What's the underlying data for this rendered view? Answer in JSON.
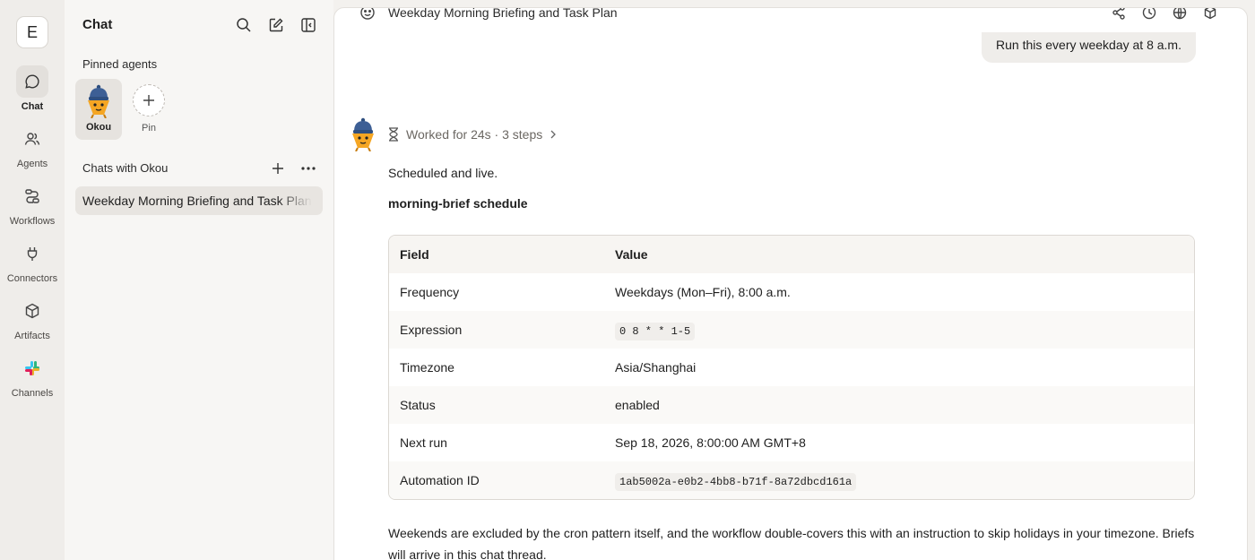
{
  "rail": {
    "workspace_initial": "E",
    "items": [
      {
        "label": "Chat",
        "icon": "chat-bubble-icon"
      },
      {
        "label": "Agents",
        "icon": "users-icon"
      },
      {
        "label": "Workflows",
        "icon": "workflow-icon"
      },
      {
        "label": "Connectors",
        "icon": "plug-icon"
      },
      {
        "label": "Artifacts",
        "icon": "cube-icon"
      },
      {
        "label": "Channels",
        "icon": "slack-icon"
      }
    ]
  },
  "sidebar": {
    "title": "Chat",
    "pinned_label": "Pinned agents",
    "agent_name": "Okou",
    "pin_label": "Pin",
    "chats_label": "Chats with Okou",
    "chat_item": "Weekday Morning Briefing and Task Plan"
  },
  "main": {
    "title": "Weekday Morning Briefing and Task Plan",
    "user_message": "Run this every weekday at 8 a.m.",
    "worked": "Worked for 24s · 3 steps",
    "status_line": "Scheduled and live.",
    "schedule_heading": "morning-brief schedule",
    "table": {
      "headers": [
        "Field",
        "Value"
      ],
      "rows": [
        {
          "field": "Frequency",
          "value": "Weekdays (Mon–Fri), 8:00 a.m."
        },
        {
          "field": "Expression",
          "value": "0 8 * * 1-5"
        },
        {
          "field": "Timezone",
          "value": "Asia/Shanghai"
        },
        {
          "field": "Status",
          "value": "enabled"
        },
        {
          "field": "Next run",
          "value": "Sep 18, 2026, 8:00:00 AM GMT+8"
        },
        {
          "field": "Automation ID",
          "value": "1ab5002a-e0b2-4bb8-b71f-8a72dbcd161a"
        }
      ]
    },
    "footer": "Weekends are excluded by the cron pattern itself, and the workflow double-covers this with an instruction to skip holidays in your timezone. Briefs will arrive in this chat thread."
  }
}
